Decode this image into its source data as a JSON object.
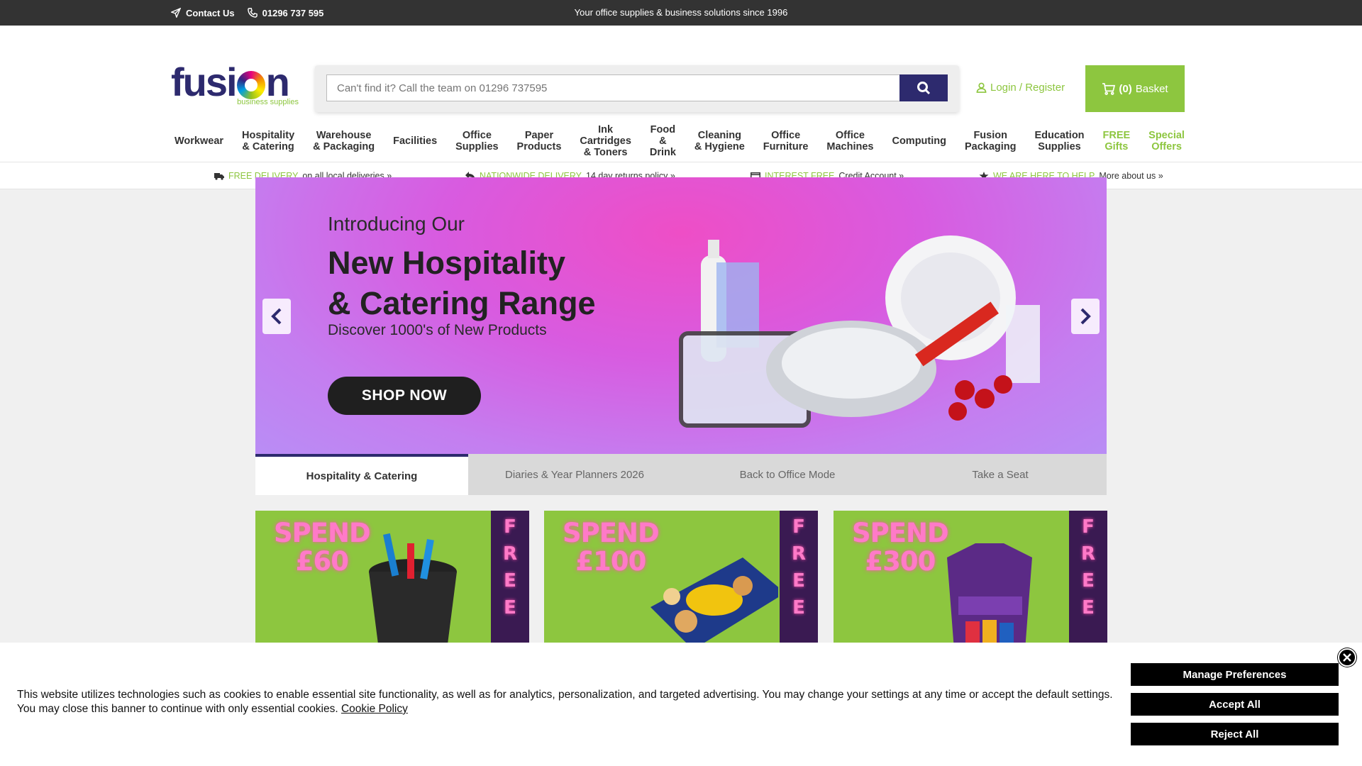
{
  "topbar": {
    "contact_label": "Contact Us",
    "phone": "01296 737 595",
    "tagline": "Your office supplies & business solutions since 1996"
  },
  "logo": {
    "word_left": "fusi",
    "word_right": "n",
    "subtitle": "business supplies"
  },
  "search": {
    "placeholder": "Can't find it? Call the team on 01296 737595",
    "button_icon": "search-icon"
  },
  "account": {
    "login_label": "Login / Register",
    "basket_count": "(0)",
    "basket_label": "Basket"
  },
  "nav": [
    {
      "label": "Workwear"
    },
    {
      "label": "Hospitality\n& Catering"
    },
    {
      "label": "Warehouse\n& Packaging"
    },
    {
      "label": "Facilities"
    },
    {
      "label": "Office\nSupplies"
    },
    {
      "label": "Paper\nProducts"
    },
    {
      "label": "Ink\nCartridges\n& Toners"
    },
    {
      "label": "Food\n&\nDrink"
    },
    {
      "label": "Cleaning\n& Hygiene"
    },
    {
      "label": "Office\nFurniture"
    },
    {
      "label": "Office\nMachines"
    },
    {
      "label": "Computing"
    },
    {
      "label": "Fusion\nPackaging"
    },
    {
      "label": "Education\nSupplies"
    },
    {
      "label": "FREE\nGifts"
    },
    {
      "label": "Special\nOffers"
    }
  ],
  "usp": [
    {
      "highlight": "FREE DELIVERY",
      "text": "on all local deliveries »",
      "icon": "truck-icon"
    },
    {
      "highlight": "NATIONWIDE DELIVERY",
      "text": "14 day returns policy »",
      "icon": "return-icon"
    },
    {
      "highlight": "INTEREST FREE",
      "text": "Credit Account »",
      "icon": "credit-card-icon"
    },
    {
      "highlight": "WE ARE HERE TO HELP",
      "text": "More about us »",
      "icon": "star-icon"
    }
  ],
  "hero": {
    "intro": "Introducing Our",
    "headline_1": "New Hospitality",
    "headline_2": "& Catering Range",
    "discover": "Discover 1000's of New Products",
    "cta": "SHOP NOW"
  },
  "tabs": [
    {
      "label": "Hospitality & Catering",
      "active": true
    },
    {
      "label": "Diaries & Year Planners 2026",
      "active": false
    },
    {
      "label": "Back to Office Mode",
      "active": false
    },
    {
      "label": "Take a Seat",
      "active": false
    }
  ],
  "promos": [
    {
      "spend": "SPEND",
      "amount": "£60",
      "band": "FREE GI"
    },
    {
      "spend": "SPEND",
      "amount": "£100",
      "band": "FREE GI"
    },
    {
      "spend": "SPEND",
      "amount": "£300",
      "band": "FREE GI"
    }
  ],
  "cookie": {
    "text": "This website utilizes technologies such as cookies to enable essential site functionality, as well as for analytics, personalization, and targeted advertising. You may change your settings at any time or accept the default settings. You may close this banner to continue with only essential cookies.",
    "policy_link": "Cookie Policy",
    "manage": "Manage Preferences",
    "accept": "Accept All",
    "reject": "Reject All"
  },
  "colors": {
    "brand_navy": "#2d2a6e",
    "brand_green": "#8dc63f",
    "topbar": "#333333"
  }
}
